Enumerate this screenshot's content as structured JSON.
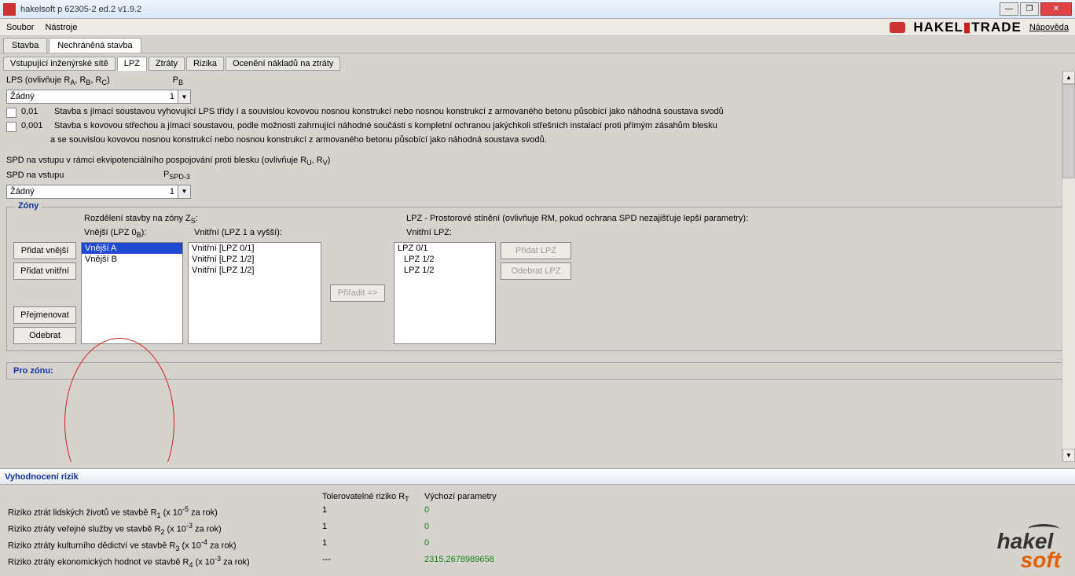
{
  "window": {
    "title": "hakelsoft p 62305-2 ed.2 v1.9.2"
  },
  "menu": {
    "file": "Soubor",
    "tools": "Nástroje",
    "brand_h": "HAKEL",
    "brand_t": "TRADE",
    "help": "Nápověda"
  },
  "tabs": {
    "main": [
      "Stavba",
      "Nechráněná stavba"
    ],
    "main_active": 1,
    "sub": [
      "Vstupující inženýrské sítě",
      "LPZ",
      "Ztráty",
      "Rizika",
      "Ocenění nákladů na ztráty"
    ],
    "sub_active": 1
  },
  "lps": {
    "title": "LPS (ovlivňuje R",
    "title_sub": "A",
    "title2": ", R",
    "title_sub2": "B",
    "title3": ", R",
    "title_sub3": "C",
    "title4": ")",
    "p_lbl": "P",
    "p_sub": "B",
    "dd_value": "Žádný",
    "dd_num": "1",
    "chk1_val": "0,01",
    "chk1_txt": "Stavba s jímací soustavou vyhovující LPS třídy I a souvislou kovovou nosnou konstrukcí nebo nosnou konstrukcí z armovaného betonu působící jako náhodná soustava svodů",
    "chk2_val": "0,001",
    "chk2_txt": "Stavba s kovovou střechou a jímací soustavou, podle možnosti zahrnující náhodné součásti s kompletní ochranou jakýchkoli střešních instalací proti přímým zásahům blesku",
    "chk2_cont": "a se souvislou kovovou nosnou konstrukcí nebo nosnou konstrukcí z armovaného betonu působící jako náhodná soustava svodů."
  },
  "spd": {
    "heading": "SPD na vstupu v rámci ekvipotenciálního pospojování proti blesku (ovlivňuje R",
    "h_sub1": "U",
    "h_mid": ", R",
    "h_sub2": "V",
    "h_end": ")",
    "label": "SPD na vstupu",
    "p_lbl": "P",
    "p_sub": "SPD-3",
    "dd_value": "Žádný",
    "dd_num": "1"
  },
  "zones": {
    "legend": "Zóny",
    "rozdeleni": "Rozdělení stavby na zóny Z",
    "rozdeleni_sub": "S",
    "rozdeleni_end": ":",
    "lpz_stineni": "LPZ - Prostorové stínění (ovlivňuje RM, pokud ochrana SPD nezajišťuje lepší parametry):",
    "col_vnejsi": "Vnější (LPZ 0",
    "col_vnejsi_sub": "B",
    "col_vnejsi_end": "):",
    "col_vnitrni": "Vnitřní (LPZ 1 a vyšší):",
    "col_lpz": "Vnitřní LPZ:",
    "btn_add_ext": "Přidat vnější",
    "btn_add_int": "Přidat vnitřní",
    "btn_rename": "Přejmenovat",
    "btn_remove": "Odebrat",
    "btn_assign": "Přiřadit =>",
    "btn_add_lpz": "Přidat LPZ",
    "btn_remove_lpz": "Odebrat LPZ",
    "list_vnejsi": [
      "Vnější A",
      "Vnější B"
    ],
    "list_vnitrni": [
      "Vnitřní [LPZ 0/1]",
      "Vnitřní [LPZ 1/2]",
      "Vnitřní [LPZ 1/2]"
    ],
    "list_lpz": [
      "LPZ 0/1",
      "LPZ 1/2",
      "LPZ 1/2"
    ]
  },
  "pro_zonu": "Pro zónu:",
  "eval": {
    "title": "Vyhodnocení rizik",
    "col_tol": "Tolerovatelné riziko R",
    "col_tol_sub": "T",
    "col_val": "Výchozí parametry",
    "rows": [
      {
        "name": "Riziko ztrát lidských životů ve stavbě R",
        "sub": "1",
        "exp": " (x 10",
        "expv": "-5",
        "exp2": " za rok)",
        "tol": "1",
        "val": "0"
      },
      {
        "name": "Riziko ztráty veřejné služby ve stavbě R",
        "sub": "2",
        "exp": " (x 10",
        "expv": "-3",
        "exp2": " za rok)",
        "tol": "1",
        "val": "0"
      },
      {
        "name": "Riziko ztráty kulturního dědictví ve stavbě R",
        "sub": "3",
        "exp": " (x 10",
        "expv": "-4",
        "exp2": " za rok)",
        "tol": "1",
        "val": "0"
      },
      {
        "name": "Riziko ztráty ekonomických hodnot ve stavbě R",
        "sub": "4",
        "exp": " (x 10",
        "expv": "-3",
        "exp2": " za rok)",
        "tol": "---",
        "val": "2315,2678989658"
      }
    ]
  }
}
